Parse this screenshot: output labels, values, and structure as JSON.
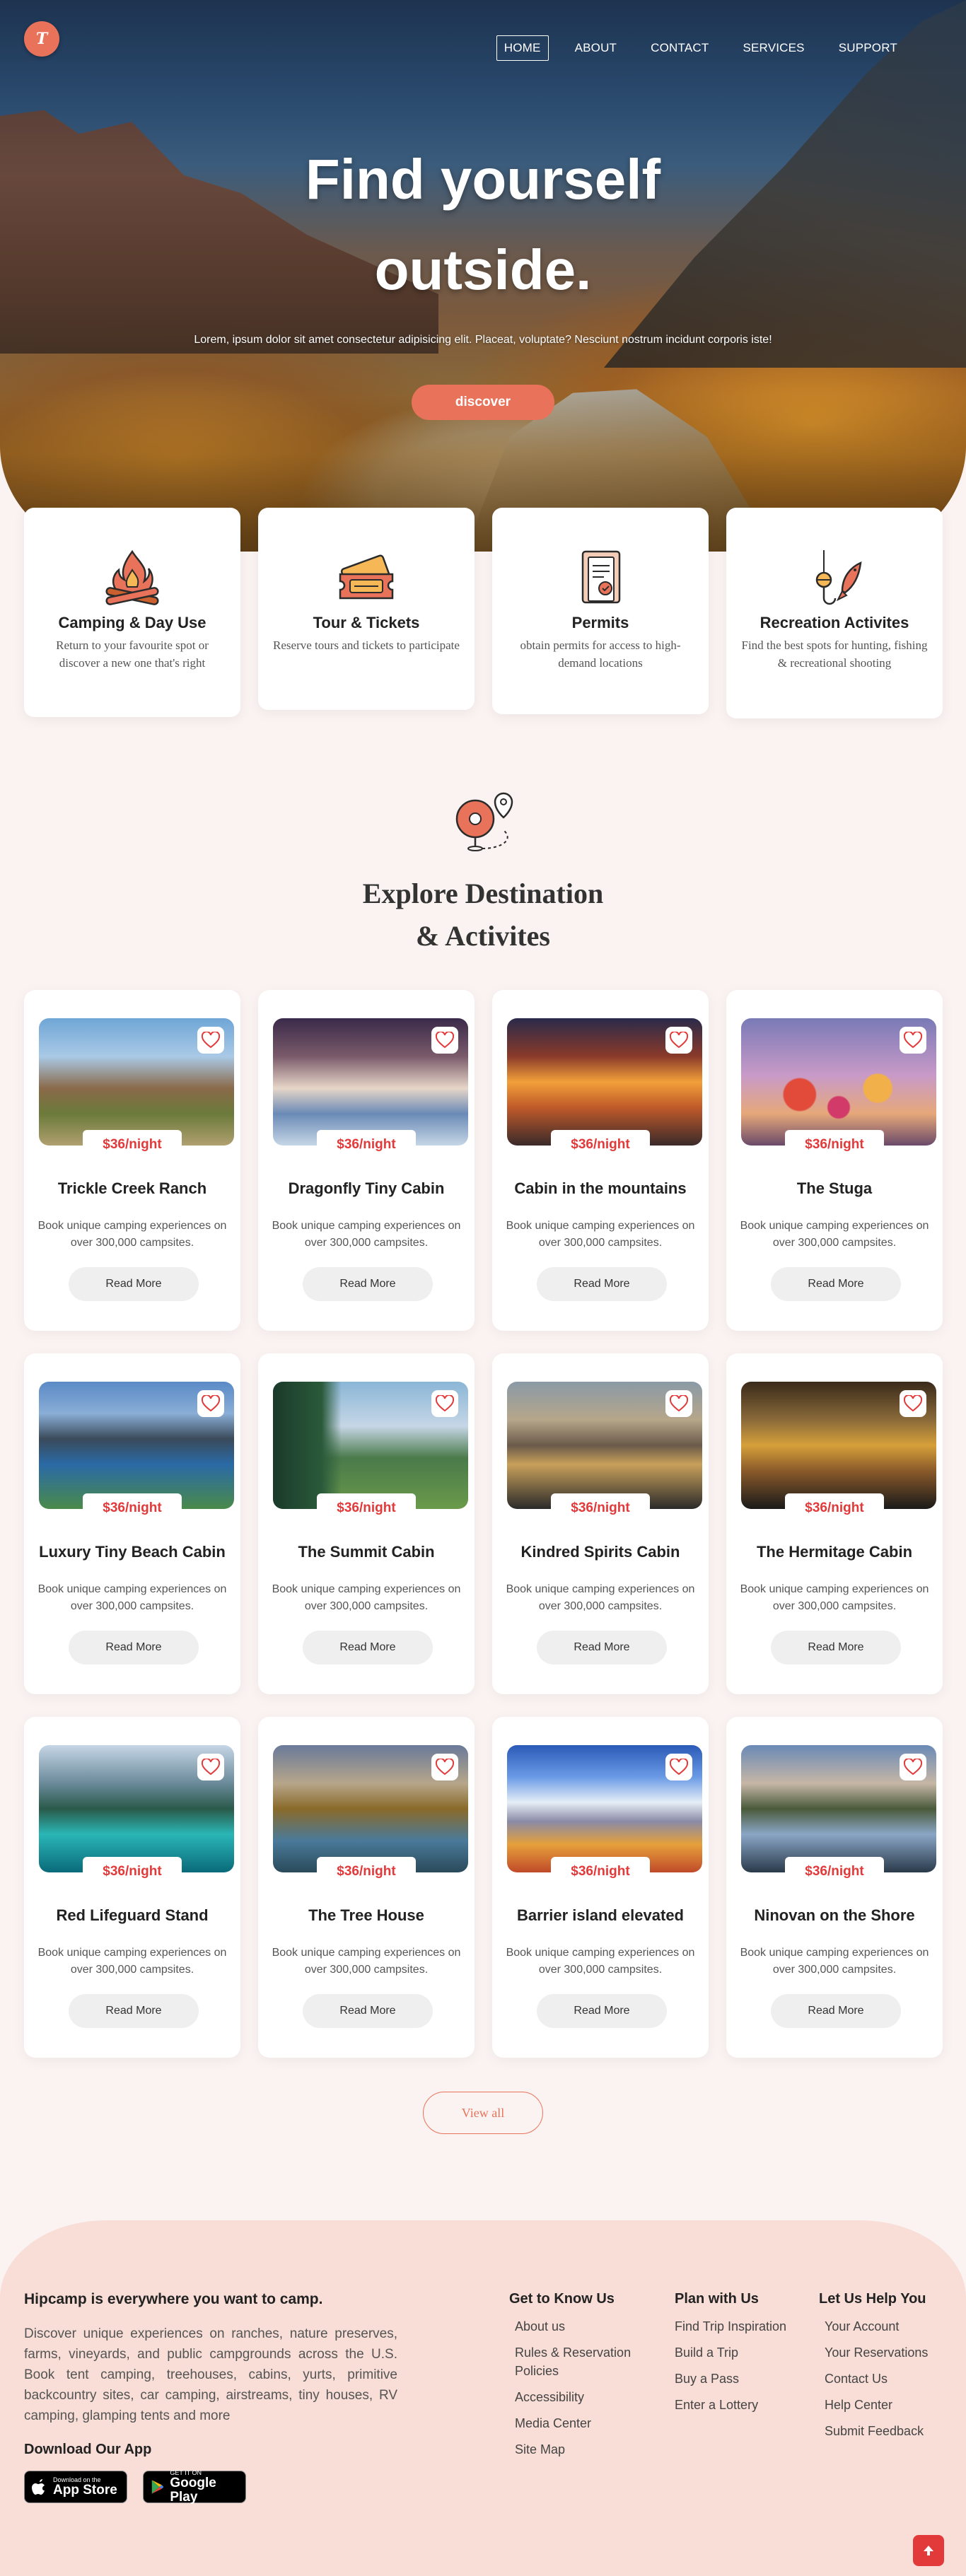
{
  "brand": {
    "logo_letter": "T",
    "accent": "#e8735a",
    "price_color": "#e23a3a"
  },
  "nav": {
    "items": [
      {
        "label": "HOME",
        "active": true
      },
      {
        "label": "ABOUT"
      },
      {
        "label": "CONTACT"
      },
      {
        "label": "SERVICES"
      },
      {
        "label": "SUPPORT"
      }
    ]
  },
  "hero": {
    "title_line1": "Find yourself",
    "title_line2": "outside.",
    "subtitle": "Lorem, ipsum dolor sit amet consectetur adipisicing elit. Placeat, voluptate? Nesciunt nostrum incidunt corporis iste!",
    "cta": "discover"
  },
  "services": [
    {
      "icon": "campfire-icon",
      "title": "Camping & Day Use",
      "text": "Return to your favourite spot or discover a new one that's right"
    },
    {
      "icon": "tickets-icon",
      "title": "Tour & Tickets",
      "text": "Reserve tours and tickets to participate"
    },
    {
      "icon": "permit-icon",
      "title": "Permits",
      "text": "obtain permits for access to high-demand locations"
    },
    {
      "icon": "fishing-icon",
      "title": "Recreation Activites",
      "text": "Find the best spots for hunting, fishing & recreational shooting"
    }
  ],
  "explore": {
    "icon": "map-pin-route-icon",
    "title_line1": "Explore Destination",
    "title_line2": "& Activites"
  },
  "destinations": [
    {
      "name": "Trickle Creek Ranch",
      "price": "$36/night",
      "desc": "Book unique camping experiences on over 300,000 campsites.",
      "cta": "Read More",
      "scene": "canyon"
    },
    {
      "name": "Dragonfly Tiny Cabin",
      "price": "$36/night",
      "desc": "Book unique camping experiences on over 300,000 campsites.",
      "cta": "Read More",
      "scene": "terraces"
    },
    {
      "name": "Cabin in the mountains",
      "price": "$36/night",
      "desc": "Book unique camping experiences on over 300,000 campsites.",
      "cta": "Read More",
      "scene": "sunset"
    },
    {
      "name": "The Stuga",
      "price": "$36/night",
      "desc": "Book unique camping experiences on over 300,000 campsites.",
      "cta": "Read More",
      "scene": "balloons"
    },
    {
      "name": "Luxury Tiny Beach Cabin",
      "price": "$36/night",
      "desc": "Book unique camping experiences on over 300,000 campsites.",
      "cta": "Read More",
      "scene": "lake-blue"
    },
    {
      "name": "The Summit Cabin",
      "price": "$36/night",
      "desc": "Book unique camping experiences on over 300,000 campsites.",
      "cta": "Read More",
      "scene": "forest"
    },
    {
      "name": "Kindred Spirits Cabin",
      "price": "$36/night",
      "desc": "Book unique camping experiences on over 300,000 campsites.",
      "cta": "Read More",
      "scene": "mountain-lake"
    },
    {
      "name": "The Hermitage Cabin",
      "price": "$36/night",
      "desc": "Book unique camping experiences on over 300,000 campsites.",
      "cta": "Read More",
      "scene": "golden-lake"
    },
    {
      "name": "Red Lifeguard Stand",
      "price": "$36/night",
      "desc": "Book unique camping experiences on over 300,000 campsites.",
      "cta": "Read More",
      "scene": "turquoise"
    },
    {
      "name": "The Tree House",
      "price": "$36/night",
      "desc": "Book unique camping experiences on over 300,000 campsites.",
      "cta": "Read More",
      "scene": "autumn-lake"
    },
    {
      "name": "Barrier island elevated",
      "price": "$36/night",
      "desc": "Book unique camping experiences on over 300,000 campsites.",
      "cta": "Read More",
      "scene": "snow-peak"
    },
    {
      "name": "Ninovan on the Shore",
      "price": "$36/night",
      "desc": "Book unique camping experiences on over 300,000 campsites.",
      "cta": "Read More",
      "scene": "dusk-lake"
    }
  ],
  "view_all": "View all",
  "footer": {
    "about_title": "Hipcamp is everywhere you want to camp.",
    "about_text": "Discover unique experiences on ranches, nature preserves, farms, vineyards, and public campgrounds across the U.S. Book tent camping, treehouses, cabins, yurts, primitive backcountry sites, car camping, airstreams, tiny houses, RV camping, glamping tents and more",
    "app_title": "Download Our App",
    "app_store": {
      "small": "Download on the",
      "big": "App Store"
    },
    "google_play": {
      "small": "GET IT ON",
      "big": "Google Play"
    },
    "columns": [
      {
        "title": "Get to Know Us",
        "links": [
          "About us",
          "Rules & Reservation Policies",
          "Accessibility",
          "Media Center",
          "Site Map"
        ]
      },
      {
        "title": "Plan with Us",
        "links": [
          "Find Trip Inspiration",
          "Build a Trip",
          "Buy a Pass",
          "Enter a Lottery"
        ]
      },
      {
        "title": "Let Us Help You",
        "links": [
          "Your Account",
          "Your Reservations",
          "Contact Us",
          "Help Center",
          "Submit Feedback"
        ]
      }
    ]
  }
}
